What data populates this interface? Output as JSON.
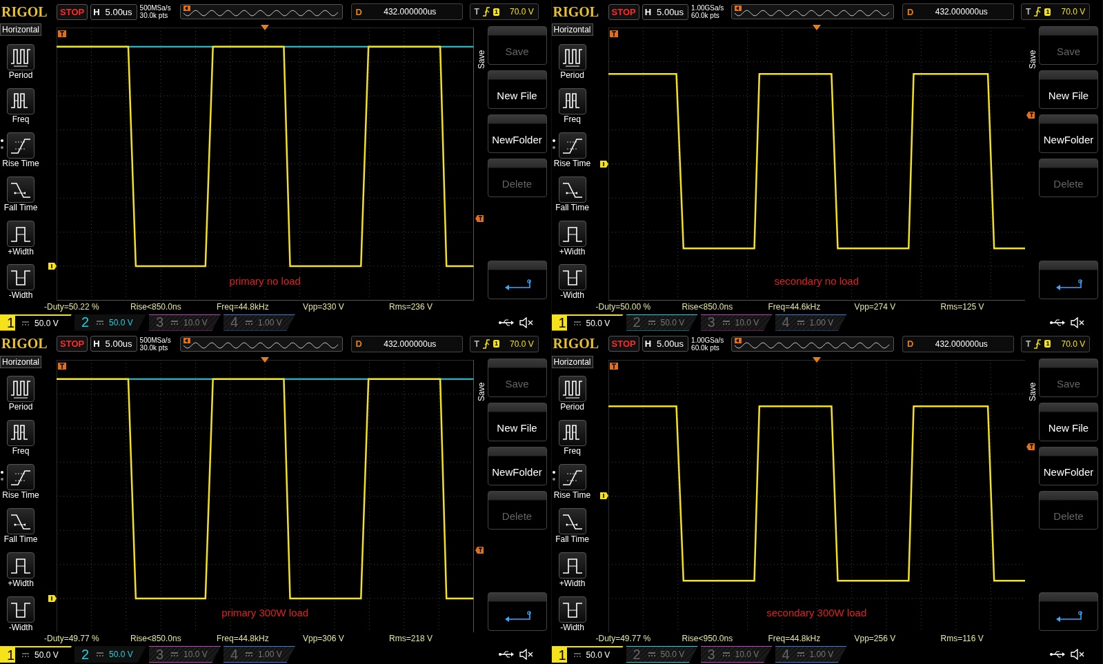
{
  "panels": [
    {
      "kind": "primary",
      "header": {
        "logo": "RIGOL",
        "run_state": "STOP",
        "timebase_label": "H",
        "timebase": "5.00us",
        "sample_rate": "500MSa/s",
        "memory_depth": "30.0k pts",
        "delay_label": "D",
        "delay": "432.000000us",
        "trigger_label": "T",
        "trigger_source": "1",
        "trigger_level": "70.0 V"
      },
      "menu": {
        "title": "Horizontal",
        "items": [
          {
            "kind": "period",
            "label": "Period"
          },
          {
            "kind": "freq",
            "label": "Freq"
          },
          {
            "kind": "rise",
            "label": "Rise Time"
          },
          {
            "kind": "fall",
            "label": "Fall Time"
          },
          {
            "kind": "pwidth",
            "label": "+Width"
          },
          {
            "kind": "nwidth",
            "label": "-Width"
          }
        ]
      },
      "save_menu": {
        "title": "Save",
        "buttons": [
          {
            "label": "Save",
            "disabled": true
          },
          {
            "label": "New File",
            "disabled": false
          },
          {
            "label": "NewFolder",
            "disabled": false
          },
          {
            "label": "Delete",
            "disabled": true
          }
        ]
      },
      "annotation": "primary no load",
      "measurements": [
        "-Duty=50.22 %",
        "Rise<850.0ns",
        "Freq=44.8kHz",
        "Vpp=330 V",
        "Rms=236 V"
      ],
      "channels": [
        {
          "number": "1",
          "scale": "50.0 V",
          "on": true,
          "color": "#f5e21b"
        },
        {
          "number": "2",
          "scale": "50.0 V",
          "on": true,
          "color": "#20d0e0"
        },
        {
          "number": "3",
          "scale": "10.0 V",
          "on": false,
          "color": "#c040c0"
        },
        {
          "number": "4",
          "scale": "1.00 V",
          "on": false,
          "color": "#3a7ad8"
        }
      ]
    },
    {
      "kind": "secondary",
      "header": {
        "logo": "RIGOL",
        "run_state": "STOP",
        "timebase_label": "H",
        "timebase": "5.00us",
        "sample_rate": "1.00GSa/s",
        "memory_depth": "60.0k pts",
        "delay_label": "D",
        "delay": "432.000000us",
        "trigger_label": "T",
        "trigger_source": "1",
        "trigger_level": "70.0 V"
      },
      "menu": {
        "title": "Horizontal",
        "items": [
          {
            "kind": "period",
            "label": "Period"
          },
          {
            "kind": "freq",
            "label": "Freq"
          },
          {
            "kind": "rise",
            "label": "Rise Time"
          },
          {
            "kind": "fall",
            "label": "Fall Time"
          },
          {
            "kind": "pwidth",
            "label": "+Width"
          },
          {
            "kind": "nwidth",
            "label": "-Width"
          }
        ]
      },
      "save_menu": {
        "title": "Save",
        "buttons": [
          {
            "label": "Save",
            "disabled": true
          },
          {
            "label": "New File",
            "disabled": false
          },
          {
            "label": "NewFolder",
            "disabled": false
          },
          {
            "label": "Delete",
            "disabled": true
          }
        ]
      },
      "annotation": "secondary no load",
      "measurements": [
        "-Duty=50.00 %",
        "Rise<850.0ns",
        "Freq=44.6kHz",
        "Vpp=274 V",
        "Rms=125 V"
      ],
      "channels": [
        {
          "number": "1",
          "scale": "50.0 V",
          "on": true,
          "color": "#f5e21b"
        },
        {
          "number": "2",
          "scale": "50.0 V",
          "on": false,
          "color": "#20d0e0"
        },
        {
          "number": "3",
          "scale": "10.0 V",
          "on": false,
          "color": "#c040c0"
        },
        {
          "number": "4",
          "scale": "1.00 V",
          "on": false,
          "color": "#3a7ad8"
        }
      ]
    },
    {
      "kind": "primary",
      "header": {
        "logo": "RIGOL",
        "run_state": "STOP",
        "timebase_label": "H",
        "timebase": "5.00us",
        "sample_rate": "500MSa/s",
        "memory_depth": "30.0k pts",
        "delay_label": "D",
        "delay": "432.000000us",
        "trigger_label": "T",
        "trigger_source": "1",
        "trigger_level": "70.0 V"
      },
      "menu": {
        "title": "Horizontal",
        "items": [
          {
            "kind": "period",
            "label": "Period"
          },
          {
            "kind": "freq",
            "label": "Freq"
          },
          {
            "kind": "rise",
            "label": "Rise Time"
          },
          {
            "kind": "fall",
            "label": "Fall Time"
          },
          {
            "kind": "pwidth",
            "label": "+Width"
          },
          {
            "kind": "nwidth",
            "label": "-Width"
          }
        ]
      },
      "save_menu": {
        "title": "Save",
        "buttons": [
          {
            "label": "Save",
            "disabled": true
          },
          {
            "label": "New File",
            "disabled": false
          },
          {
            "label": "NewFolder",
            "disabled": false
          },
          {
            "label": "Delete",
            "disabled": true
          }
        ]
      },
      "annotation": "primary 300W load",
      "measurements": [
        "-Duty=49.77 %",
        "Rise<850.0ns",
        "Freq=44.8kHz",
        "Vpp=306 V",
        "Rms=218 V"
      ],
      "channels": [
        {
          "number": "1",
          "scale": "50.0 V",
          "on": true,
          "color": "#f5e21b"
        },
        {
          "number": "2",
          "scale": "50.0 V",
          "on": true,
          "color": "#20d0e0"
        },
        {
          "number": "3",
          "scale": "10.0 V",
          "on": false,
          "color": "#c040c0"
        },
        {
          "number": "4",
          "scale": "1.00 V",
          "on": false,
          "color": "#3a7ad8"
        }
      ]
    },
    {
      "kind": "secondary",
      "header": {
        "logo": "RIGOL",
        "run_state": "STOP",
        "timebase_label": "H",
        "timebase": "5.00us",
        "sample_rate": "1.00GSa/s",
        "memory_depth": "60.0k pts",
        "delay_label": "D",
        "delay": "432.000000us",
        "trigger_label": "T",
        "trigger_source": "1",
        "trigger_level": "70.0 V"
      },
      "menu": {
        "title": "Horizontal",
        "items": [
          {
            "kind": "period",
            "label": "Period"
          },
          {
            "kind": "freq",
            "label": "Freq"
          },
          {
            "kind": "rise",
            "label": "Rise Time"
          },
          {
            "kind": "fall",
            "label": "Fall Time"
          },
          {
            "kind": "pwidth",
            "label": "+Width"
          },
          {
            "kind": "nwidth",
            "label": "-Width"
          }
        ]
      },
      "save_menu": {
        "title": "Save",
        "buttons": [
          {
            "label": "Save",
            "disabled": true
          },
          {
            "label": "New File",
            "disabled": false
          },
          {
            "label": "NewFolder",
            "disabled": false
          },
          {
            "label": "Delete",
            "disabled": true
          }
        ]
      },
      "annotation": "secondary 300W load",
      "measurements": [
        "-Duty=49.77 %",
        "Rise<950.0ns",
        "Freq=44.8kHz",
        "Vpp=256 V",
        "Rms=116 V"
      ],
      "channels": [
        {
          "number": "1",
          "scale": "50.0 V",
          "on": true,
          "color": "#f5e21b"
        },
        {
          "number": "2",
          "scale": "50.0 V",
          "on": false,
          "color": "#20d0e0"
        },
        {
          "number": "3",
          "scale": "10.0 V",
          "on": false,
          "color": "#c040c0"
        },
        {
          "number": "4",
          "scale": "1.00 V",
          "on": false,
          "color": "#3a7ad8"
        }
      ]
    }
  ]
}
